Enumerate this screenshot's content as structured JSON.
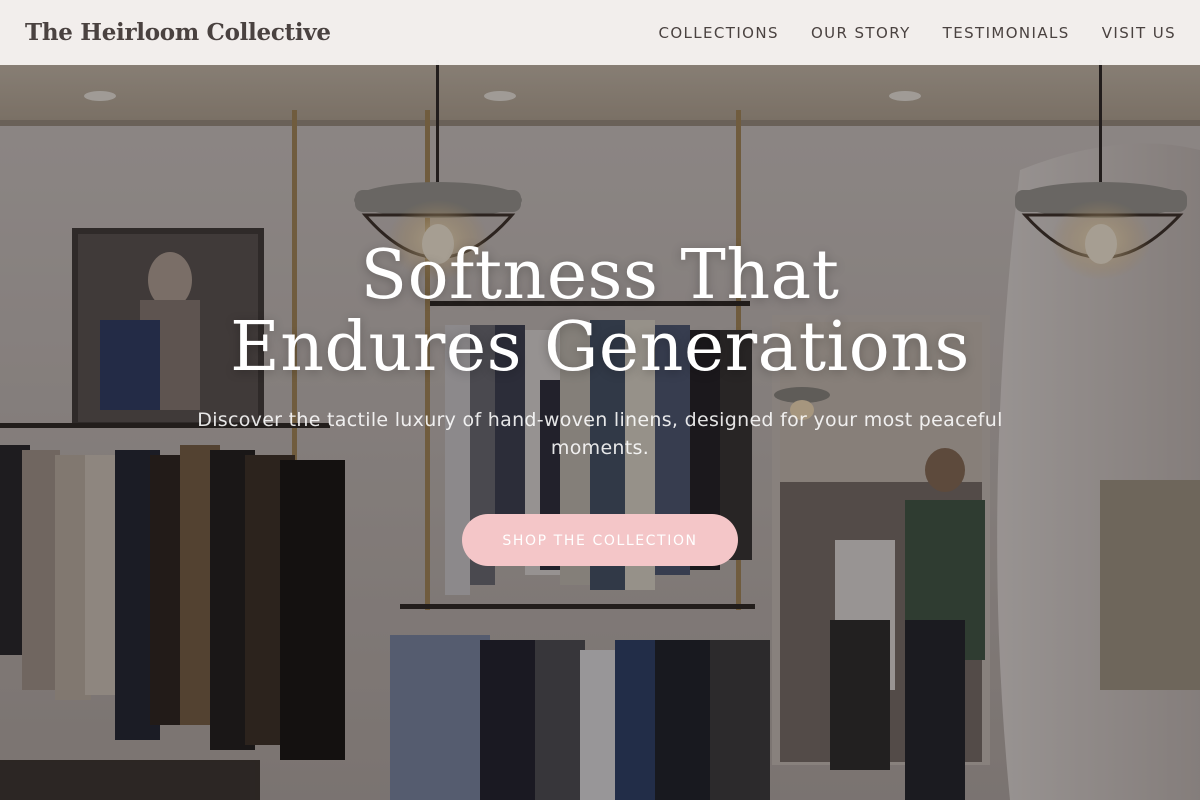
{
  "brand": {
    "name": "The Heirloom Collective"
  },
  "nav": {
    "items": [
      {
        "label": "COLLECTIONS"
      },
      {
        "label": "OUR STORY"
      },
      {
        "label": "TESTIMONIALS"
      },
      {
        "label": "VISIT US"
      }
    ]
  },
  "hero": {
    "title_line1": "Softness That",
    "title_line2": "Endures Generations",
    "subtitle": "Discover the tactile luxury of hand-woven linens, designed for your most peaceful moments.",
    "cta_label": "SHOP THE COLLECTION",
    "image_description_icon": "clothing-store-photo"
  },
  "colors": {
    "header_bg": "#f6f2f0",
    "brand_text": "#4a4240",
    "cta_bg": "#f4c6c8",
    "cta_text": "#ffffff",
    "hero_text": "#ffffff"
  }
}
